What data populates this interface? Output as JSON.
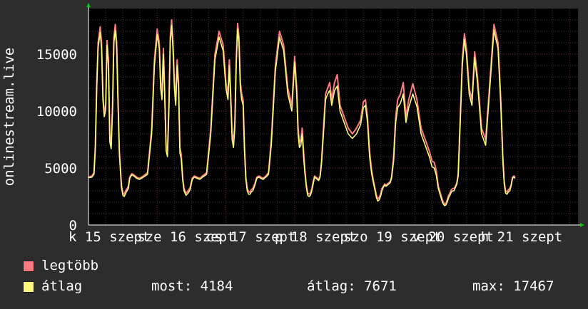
{
  "chart_data": {
    "type": "line",
    "title": "",
    "xlabel": "",
    "ylabel": "onlinestream.live",
    "ylim": [
      0,
      19000
    ],
    "yticks": [
      0,
      5000,
      10000,
      15000
    ],
    "ytick_labels": [
      "0",
      "5000",
      "10000",
      "15000"
    ],
    "x_tick_labels": [
      "k 15 szept",
      "sze 16 szept",
      "cs 17 szept",
      "p 18 szept",
      "szo 19 szept",
      "v 20 szept",
      "h 21 szept"
    ],
    "x_range_days": [
      0,
      7.2
    ],
    "grid": true,
    "series": [
      {
        "name": "legtöbb",
        "color": "#ff7b82",
        "keypoints_x_days": [
          0.0,
          0.05,
          0.08,
          0.1,
          0.12,
          0.14,
          0.17,
          0.19,
          0.21,
          0.23,
          0.25,
          0.27,
          0.29,
          0.31,
          0.33,
          0.35,
          0.37,
          0.39,
          0.41,
          0.43,
          0.45,
          0.48,
          0.5,
          0.52,
          0.55,
          0.58,
          0.6,
          0.63,
          0.66,
          0.7,
          0.74,
          0.8,
          0.86,
          0.92,
          0.96,
          1.0,
          1.03,
          1.05,
          1.07,
          1.09,
          1.11,
          1.13,
          1.15,
          1.17,
          1.19,
          1.21,
          1.23,
          1.25,
          1.27,
          1.29,
          1.31,
          1.33,
          1.35,
          1.37,
          1.39,
          1.42,
          1.45,
          1.48,
          1.51,
          1.54,
          1.58,
          1.62,
          1.66,
          1.72,
          1.78,
          1.84,
          1.9,
          1.96,
          2.0,
          2.03,
          2.05,
          2.07,
          2.09,
          2.11,
          2.13,
          2.15,
          2.17,
          2.19,
          2.21,
          2.23,
          2.25,
          2.27,
          2.29,
          2.31,
          2.33,
          2.35,
          2.37,
          2.39,
          2.42,
          2.45,
          2.48,
          2.51,
          2.54,
          2.58,
          2.62,
          2.66,
          2.72,
          2.78,
          2.84,
          2.9,
          2.96,
          3.0,
          3.03,
          3.05,
          3.07,
          3.09,
          3.11,
          3.13,
          3.15,
          3.17,
          3.19,
          3.21,
          3.23,
          3.25,
          3.27,
          3.29,
          3.31,
          3.33,
          3.35,
          3.37,
          3.39,
          3.42,
          3.45,
          3.48,
          3.51,
          3.54,
          3.58,
          3.62,
          3.66,
          3.72,
          3.78,
          3.84,
          3.9,
          3.96,
          4.0,
          4.03,
          4.06,
          4.09,
          4.12,
          4.15,
          4.17,
          4.19,
          4.21,
          4.23,
          4.25,
          4.27,
          4.29,
          4.31,
          4.33,
          4.35,
          4.37,
          4.39,
          4.41,
          4.44,
          4.47,
          4.5,
          4.54,
          4.58,
          4.62,
          4.66,
          4.72,
          4.78,
          4.84,
          4.9,
          4.96,
          5.0,
          5.03,
          5.06,
          5.09,
          5.12,
          5.15,
          5.18,
          5.2,
          5.22,
          5.24,
          5.26,
          5.28,
          5.3,
          5.32,
          5.34,
          5.36,
          5.38,
          5.41,
          5.44,
          5.47,
          5.5,
          5.54,
          5.58,
          5.62,
          5.66,
          5.72,
          5.78,
          5.84,
          5.9,
          5.96,
          6.0,
          6.03,
          6.05,
          6.07,
          6.09,
          6.11,
          6.13,
          6.15,
          6.17,
          6.19,
          6.21,
          6.23,
          6.25,
          6.27,
          6.29,
          6.31,
          6.33,
          6.35,
          6.37,
          6.39,
          6.42,
          6.45,
          6.48,
          6.51,
          6.54,
          6.58,
          6.62,
          6.66,
          6.7,
          6.74,
          6.78,
          6.82,
          6.86,
          6.9
        ],
        "keypoints_y": [
          4200,
          4300,
          4600,
          7000,
          12500,
          16000,
          17400,
          16000,
          11500,
          9800,
          10500,
          16200,
          14500,
          7800,
          7200,
          10500,
          16500,
          17600,
          16000,
          11000,
          6500,
          3500,
          2800,
          2700,
          3100,
          3400,
          4200,
          4500,
          4400,
          4200,
          4100,
          4300,
          4600,
          8500,
          14500,
          17200,
          16000,
          12500,
          11500,
          15500,
          11500,
          7000,
          6500,
          10500,
          16500,
          18000,
          16000,
          12500,
          11000,
          14500,
          12500,
          6800,
          6200,
          4200,
          3200,
          2800,
          3000,
          3300,
          4100,
          4300,
          4200,
          4100,
          4300,
          4600,
          8500,
          15000,
          17000,
          15800,
          12500,
          11500,
          14500,
          11500,
          8000,
          7300,
          9000,
          14500,
          17700,
          16500,
          12500,
          11500,
          11000,
          7000,
          4200,
          3200,
          2900,
          2900,
          3100,
          3200,
          3600,
          4200,
          4300,
          4200,
          4100,
          4300,
          4600,
          7500,
          14000,
          17000,
          15800,
          12000,
          10500,
          14800,
          12000,
          8500,
          7200,
          7500,
          8500,
          6500,
          4800,
          3500,
          2800,
          2700,
          2800,
          3200,
          3800,
          4300,
          4200,
          4100,
          4000,
          4300,
          5500,
          8500,
          11500,
          12000,
          12500,
          11000,
          12500,
          13200,
          10500,
          9500,
          8500,
          8000,
          8500,
          9200,
          10800,
          11000,
          9500,
          6500,
          4800,
          3800,
          3200,
          2600,
          2300,
          2400,
          2700,
          3200,
          3400,
          3600,
          3500,
          3600,
          3700,
          3800,
          4200,
          6000,
          9500,
          11000,
          11500,
          12500,
          9500,
          11000,
          12400,
          11000,
          8500,
          7500,
          6500,
          5600,
          5500,
          4800,
          3400,
          2800,
          2200,
          1800,
          1900,
          2200,
          2600,
          2800,
          3100,
          3200,
          3200,
          3400,
          3700,
          4500,
          9500,
          14500,
          16800,
          15500,
          12000,
          11000,
          15200,
          13000,
          8500,
          7500,
          12500,
          17600,
          16000,
          11000,
          6000,
          3800,
          3000,
          2900,
          3100,
          3200,
          3500,
          4200,
          4300,
          4200
        ]
      },
      {
        "name": "átlag",
        "color": "#fffa7a",
        "keypoints_x_days": [
          0.0,
          0.05,
          0.08,
          0.1,
          0.12,
          0.14,
          0.17,
          0.19,
          0.21,
          0.23,
          0.25,
          0.27,
          0.29,
          0.31,
          0.33,
          0.35,
          0.37,
          0.39,
          0.41,
          0.43,
          0.45,
          0.48,
          0.5,
          0.52,
          0.55,
          0.58,
          0.6,
          0.63,
          0.66,
          0.7,
          0.74,
          0.8,
          0.86,
          0.92,
          0.96,
          1.0,
          1.03,
          1.05,
          1.07,
          1.09,
          1.11,
          1.13,
          1.15,
          1.17,
          1.19,
          1.21,
          1.23,
          1.25,
          1.27,
          1.29,
          1.31,
          1.33,
          1.35,
          1.37,
          1.39,
          1.42,
          1.45,
          1.48,
          1.51,
          1.54,
          1.58,
          1.62,
          1.66,
          1.72,
          1.78,
          1.84,
          1.9,
          1.96,
          2.0,
          2.03,
          2.05,
          2.07,
          2.09,
          2.11,
          2.13,
          2.15,
          2.17,
          2.19,
          2.21,
          2.23,
          2.25,
          2.27,
          2.29,
          2.31,
          2.33,
          2.35,
          2.37,
          2.39,
          2.42,
          2.45,
          2.48,
          2.51,
          2.54,
          2.58,
          2.62,
          2.66,
          2.72,
          2.78,
          2.84,
          2.9,
          2.96,
          3.0,
          3.03,
          3.05,
          3.07,
          3.09,
          3.11,
          3.13,
          3.15,
          3.17,
          3.19,
          3.21,
          3.23,
          3.25,
          3.27,
          3.29,
          3.31,
          3.33,
          3.35,
          3.37,
          3.39,
          3.42,
          3.45,
          3.48,
          3.51,
          3.54,
          3.58,
          3.62,
          3.66,
          3.72,
          3.78,
          3.84,
          3.9,
          3.96,
          4.0,
          4.03,
          4.06,
          4.09,
          4.12,
          4.15,
          4.17,
          4.19,
          4.21,
          4.23,
          4.25,
          4.27,
          4.29,
          4.31,
          4.33,
          4.35,
          4.37,
          4.39,
          4.41,
          4.44,
          4.47,
          4.5,
          4.54,
          4.58,
          4.62,
          4.66,
          4.72,
          4.78,
          4.84,
          4.9,
          4.96,
          5.0,
          5.03,
          5.06,
          5.09,
          5.12,
          5.15,
          5.18,
          5.2,
          5.22,
          5.24,
          5.26,
          5.28,
          5.3,
          5.32,
          5.34,
          5.36,
          5.38,
          5.41,
          5.44,
          5.47,
          5.5,
          5.54,
          5.58,
          5.62,
          5.66,
          5.72,
          5.78,
          5.84,
          5.9,
          5.96,
          6.0,
          6.03,
          6.05,
          6.07,
          6.09,
          6.11,
          6.13,
          6.15,
          6.17,
          6.19,
          6.21,
          6.23,
          6.25,
          6.27,
          6.29,
          6.31,
          6.33,
          6.35,
          6.37,
          6.39,
          6.42,
          6.45,
          6.48,
          6.51,
          6.54,
          6.58,
          6.62,
          6.66,
          6.7,
          6.74,
          6.78,
          6.82,
          6.86,
          6.9
        ],
        "keypoints_y": [
          4150,
          4200,
          4450,
          6600,
          12000,
          15600,
          16900,
          15500,
          11000,
          9500,
          10100,
          15800,
          14000,
          7300,
          6700,
          10000,
          16000,
          17100,
          15500,
          10600,
          6200,
          3300,
          2600,
          2500,
          2900,
          3200,
          4100,
          4400,
          4300,
          4100,
          4000,
          4200,
          4450,
          8000,
          14000,
          16700,
          15500,
          12000,
          11000,
          15000,
          11000,
          6500,
          6000,
          10000,
          16000,
          17500,
          15500,
          12000,
          10500,
          14000,
          12000,
          6300,
          5800,
          4000,
          3000,
          2600,
          2800,
          3100,
          4000,
          4200,
          4100,
          4000,
          4200,
          4450,
          8000,
          14500,
          16500,
          15300,
          12000,
          11000,
          14000,
          11000,
          7500,
          6800,
          8500,
          14000,
          17200,
          16000,
          12000,
          11000,
          10500,
          6500,
          4000,
          3000,
          2700,
          2700,
          2900,
          3000,
          3450,
          4100,
          4200,
          4100,
          4000,
          4200,
          4450,
          7000,
          13500,
          16500,
          15300,
          11500,
          10000,
          14300,
          11500,
          8000,
          6800,
          7000,
          8000,
          6000,
          4500,
          3300,
          2600,
          2500,
          2600,
          3000,
          3600,
          4200,
          4100,
          4000,
          3900,
          4200,
          5300,
          8000,
          11000,
          11500,
          11800,
          10500,
          11800,
          12200,
          10000,
          9000,
          8000,
          7600,
          8000,
          8800,
          10300,
          10500,
          9000,
          6000,
          4500,
          3600,
          3000,
          2400,
          2100,
          2200,
          2500,
          3000,
          3300,
          3500,
          3400,
          3500,
          3600,
          3700,
          4100,
          5600,
          9000,
          10300,
          10700,
          11500,
          9000,
          10300,
          11500,
          10400,
          8000,
          7000,
          6000,
          5100,
          5000,
          4400,
          3200,
          2600,
          2000,
          1700,
          1750,
          2000,
          2400,
          2600,
          2900,
          3000,
          3000,
          3300,
          3600,
          4300,
          9000,
          14000,
          16300,
          15000,
          11500,
          10500,
          14700,
          12500,
          8000,
          7000,
          12000,
          17100,
          15500,
          10500,
          5600,
          3600,
          2800,
          2700,
          2900,
          3000,
          3400,
          4100,
          4200,
          4100
        ]
      }
    ]
  },
  "legend": {
    "items": [
      {
        "label": "legtöbb",
        "color": "#ff7b82"
      },
      {
        "label": "átlag",
        "color": "#fffa7a"
      }
    ],
    "stats": {
      "now": "most: 4184",
      "avg": "átlag: 7671",
      "max": "max: 17467"
    }
  }
}
